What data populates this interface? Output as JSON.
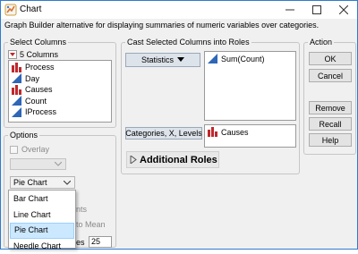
{
  "window": {
    "title": "Chart",
    "subtitle": "Graph Builder alternative for displaying summaries of numeric variables over categories."
  },
  "select_columns": {
    "label": "Select Columns",
    "count_label": "5 Columns",
    "items": [
      {
        "name": "Process",
        "icon": "nominal-bar-icon"
      },
      {
        "name": "Day",
        "icon": "continuous-triangle-icon"
      },
      {
        "name": "Causes",
        "icon": "nominal-bar-icon"
      },
      {
        "name": "Count",
        "icon": "continuous-triangle-icon"
      },
      {
        "name": "IProcess",
        "icon": "continuous-triangle-icon"
      }
    ]
  },
  "roles": {
    "label": "Cast Selected Columns into Roles",
    "statistics_button": "Statistics",
    "statistics_assigned": "Sum(Count)",
    "categories_button": "Categories, X, Levels",
    "categories_assigned": "Causes",
    "additional_roles": "Additional Roles"
  },
  "action": {
    "label": "Action",
    "ok": "OK",
    "cancel": "Cancel",
    "remove": "Remove",
    "recall": "Recall",
    "help": "Help"
  },
  "options": {
    "label": "Options",
    "overlay": "Overlay",
    "chart_type_selected": "Pie Chart",
    "menu_items": [
      "Bar Chart",
      "Line Chart",
      "Pie Chart",
      "Needle Chart"
    ],
    "selected_index": 2,
    "obscured_text_1": "nts",
    "obscured_text_2": "to Mean",
    "obscured_text_3": "es",
    "number_value": "25"
  },
  "colors": {
    "accent": "#2e7bcf",
    "nominal_icon": "#c0282d",
    "continuous_icon": "#2e66b8",
    "menu_highlight": "#cce8ff"
  }
}
